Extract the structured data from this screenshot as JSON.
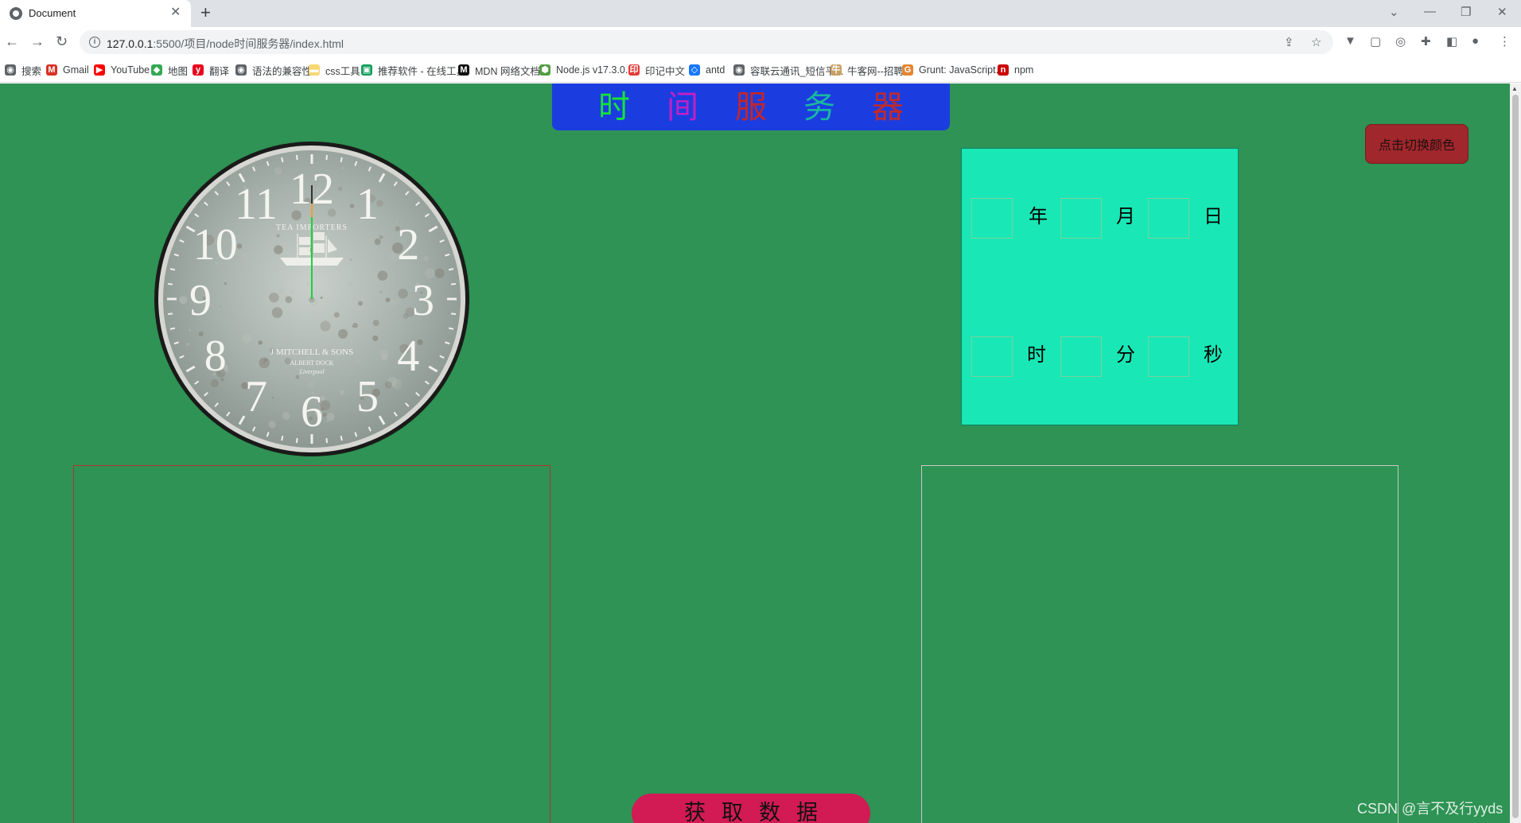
{
  "browser": {
    "tab_title": "Document",
    "url_host": "127.0.0.1",
    "url_path": ":5500/项目/node时间服务器/index.html",
    "bookmarks": [
      {
        "label": "搜索",
        "icon": "globe-icon",
        "color": "#5f6368"
      },
      {
        "label": "Gmail",
        "icon": "gmail-icon",
        "color": "#d93025"
      },
      {
        "label": "YouTube",
        "icon": "youtube-icon",
        "color": "#ff0000"
      },
      {
        "label": "地图",
        "icon": "maps-icon",
        "color": "#34a853"
      },
      {
        "label": "翻译",
        "icon": "translate-icon",
        "color": "#e8001c"
      },
      {
        "label": "语法的兼容性",
        "icon": "globe-icon",
        "color": "#5f6368"
      },
      {
        "label": "css工具",
        "icon": "folder-icon",
        "color": "#f7d774"
      },
      {
        "label": "推荐软件 - 在线工具",
        "icon": "tool-icon",
        "color": "#0f9d58"
      },
      {
        "label": "MDN 网络文档",
        "icon": "mdn-icon",
        "color": "#111111"
      },
      {
        "label": "Node.js v17.3.0...",
        "icon": "nodejs-icon",
        "color": "#539e43"
      },
      {
        "label": "印记中文",
        "icon": "yinji-icon",
        "color": "#e53935"
      },
      {
        "label": "antd",
        "icon": "antd-icon",
        "color": "#1677ff"
      },
      {
        "label": "容联云通讯_短信平...",
        "icon": "globe-icon",
        "color": "#5f6368"
      },
      {
        "label": "牛客网--招聘",
        "icon": "nowcoder-icon",
        "color": "#c8a064"
      },
      {
        "label": "Grunt: JavaScript...",
        "icon": "grunt-icon",
        "color": "#e48632"
      },
      {
        "label": "npm",
        "icon": "npm-icon",
        "color": "#cb0000"
      }
    ]
  },
  "page": {
    "title_chars": [
      {
        "char": "时",
        "color": "#16e33a"
      },
      {
        "char": "间",
        "color": "#c21fc6"
      },
      {
        "char": "服",
        "color": "#c4262a"
      },
      {
        "char": "务",
        "color": "#19b8a0"
      },
      {
        "char": "器",
        "color": "#c22a2a"
      }
    ],
    "switch_button_label": "点击切换颜色",
    "date_labels": {
      "year": "年",
      "month": "月",
      "day": "日",
      "hour": "时",
      "minute": "分",
      "second": "秒"
    },
    "clock": {
      "brand_top": "TEA IMPORTERS",
      "brand_mid": "J MITCHELL & SONS",
      "brand_sub1": "ALBERT DOCK",
      "brand_sub2": "Liverpool",
      "numerals": [
        "12",
        "1",
        "2",
        "3",
        "4",
        "5",
        "6",
        "7",
        "8",
        "9",
        "10",
        "11"
      ]
    },
    "fetch_button_chars": [
      "获",
      "取",
      "数",
      "据"
    ],
    "watermark": "CSDN @言不及行yyds"
  }
}
